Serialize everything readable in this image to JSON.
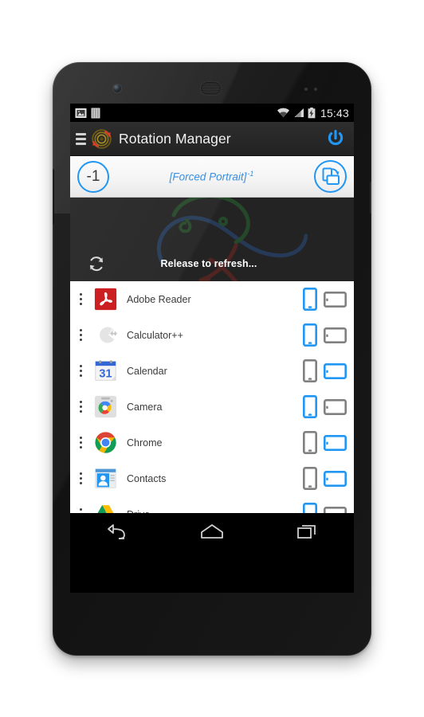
{
  "device": {
    "name": "android-phone-mockup",
    "hardware": [
      "front-camera",
      "earpiece-speaker",
      "proximity-sensor",
      "volume-rocker",
      "power-button"
    ]
  },
  "status_bar": {
    "time": "15:43",
    "left_icons": [
      "screenshot-icon",
      "sd-card-icon"
    ],
    "right_icons": [
      "wifi-icon",
      "signal-icon",
      "battery-charging-icon"
    ]
  },
  "action_bar": {
    "menu_icon": "hamburger-menu-icon",
    "logo_icon": "rotation-manager-logo-icon",
    "title": "Rotation Manager",
    "power_icon": "power-toggle-icon",
    "accent_color": "#2196f3"
  },
  "rotation_bar": {
    "counter": "-1",
    "status_text": "[Forced Portrait]",
    "status_superscript": "-1",
    "mode_icon": "screen-rotation-icon",
    "accent_color": "#2196f3",
    "text_color": "#3b8ede"
  },
  "refresh": {
    "label": "Release to refresh...",
    "icon": "refresh-icon"
  },
  "app_list": {
    "portrait_icon": "portrait-orientation-icon",
    "landscape_icon": "landscape-orientation-icon",
    "selected_color": "#2196f3",
    "unselected_color": "#808080",
    "rows": [
      {
        "name": "Adobe Reader",
        "icon": "adobe-reader-icon",
        "portrait_selected": true,
        "landscape_selected": false
      },
      {
        "name": "Calculator++",
        "icon": "calculator-plus-plus-icon",
        "portrait_selected": true,
        "landscape_selected": false
      },
      {
        "name": "Calendar",
        "icon": "calendar-icon",
        "portrait_selected": false,
        "landscape_selected": true
      },
      {
        "name": "Camera",
        "icon": "camera-icon",
        "portrait_selected": true,
        "landscape_selected": false
      },
      {
        "name": "Chrome",
        "icon": "chrome-icon",
        "portrait_selected": false,
        "landscape_selected": true
      },
      {
        "name": "Contacts",
        "icon": "contacts-icon",
        "portrait_selected": false,
        "landscape_selected": true
      },
      {
        "name": "Drive",
        "icon": "drive-icon",
        "portrait_selected": true,
        "landscape_selected": false
      }
    ]
  },
  "nav_bar": {
    "buttons": [
      {
        "name": "back-button",
        "icon": "back-arrow-icon"
      },
      {
        "name": "home-button",
        "icon": "home-icon"
      },
      {
        "name": "recents-button",
        "icon": "recents-icon"
      }
    ]
  }
}
